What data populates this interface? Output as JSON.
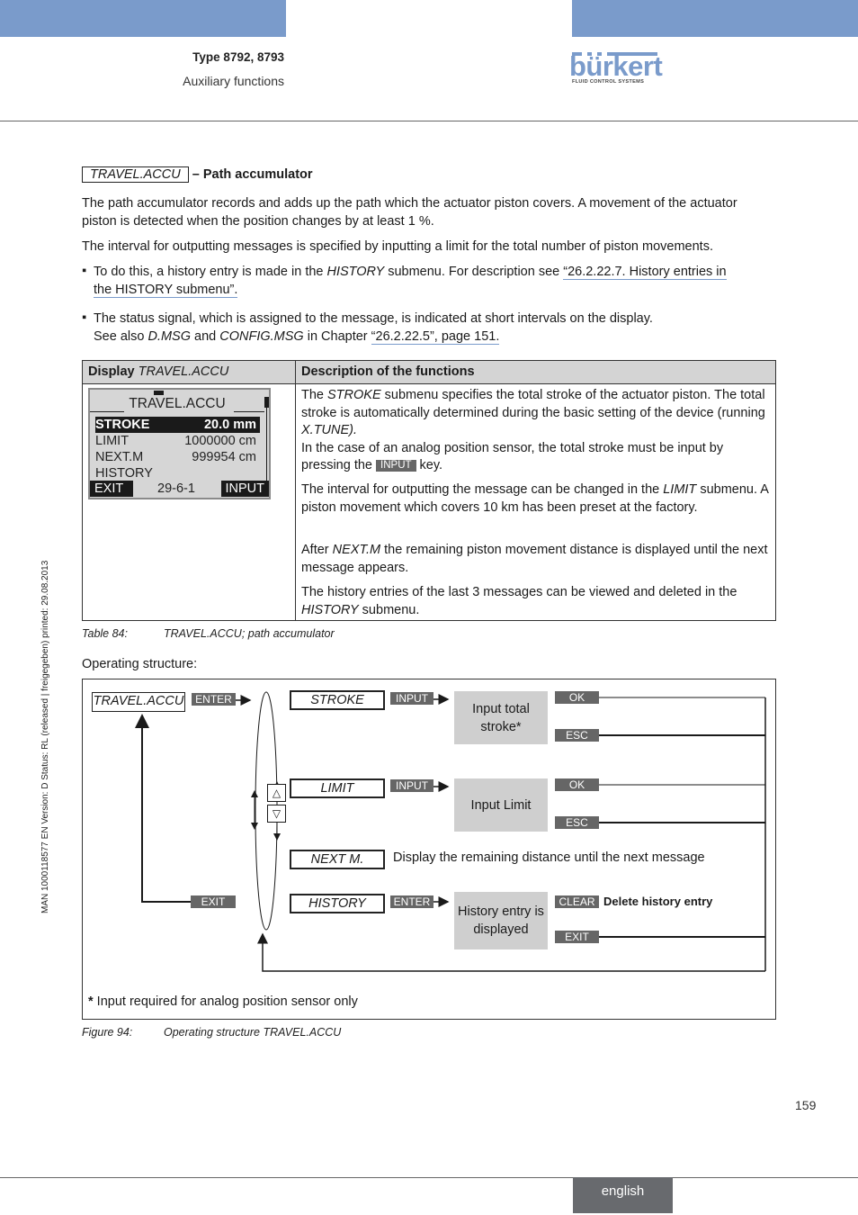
{
  "header": {
    "type": "Type 8792, 8793",
    "section": "Auxiliary functions",
    "brand": "bürkert",
    "brand_tagline": "FLUID CONTROL SYSTEMS",
    "brand_color": "#7a9bcb"
  },
  "side_note": "MAN  1000118577  EN  Version: D  Status: RL (released | freigegeben)  printed: 29.08.2013",
  "section": {
    "menu_label": "TRAVEL.ACCU",
    "title": "– Path accumulator",
    "para1": "The path accumulator records and adds up the path which the actuator piston covers. A movement of the actuator piston is detected when the position changes by at least 1 %.",
    "para2": "The interval for outputting messages is specified by inputting a limit for the total number of piston movements.",
    "bullet1": {
      "pre": "To do this, a history entry is made in the ",
      "em": "HISTORY",
      "mid": " submenu. For description see ",
      "link1": "“26.2.22.7. History entries in ",
      "link2": "the HISTORY submenu”."
    },
    "bullet2": {
      "line1": "The status signal, which is assigned to the message, is indicated at short intervals on the display.",
      "pre": "See also ",
      "em1": "D.MSG",
      "and": " and ",
      "em2": "CONFIG.MSG",
      "mid": " in Chapter ",
      "link": "“26.2.22.5”, page 151."
    }
  },
  "table": {
    "col1_header_bold": "Display ",
    "col1_header_italic": "TRAVEL.ACCU",
    "col2_header": "Description of the functions",
    "lcd": {
      "title": "TRAVEL.ACCU",
      "rows": [
        {
          "label": "STROKE",
          "value": "20.0 mm",
          "selected": true
        },
        {
          "label": "LIMIT",
          "value": "1000000 cm",
          "selected": false
        },
        {
          "label": "NEXT.M",
          "value": "999954 cm",
          "selected": false
        },
        {
          "label": "HISTORY",
          "value": "",
          "selected": false
        }
      ],
      "left_key": "EXIT",
      "middle": "29-6-1",
      "right_key": "INPUT"
    },
    "desc": {
      "p1_a": "The ",
      "p1_em": "STROKE",
      "p1_b": " submenu specifies the total stroke of the actuator piston. The total stroke is automatically determined during the basic setting of the device (running ",
      "p1_em2": "X.TUNE).",
      "p1_c": "In the case of an analog position sensor, the total stroke must be input by pressing the ",
      "p1_key": "INPUT",
      "p1_d": " key.",
      "p2_a": "The interval for outputting the message can be changed in the ",
      "p2_em": "LIMIT",
      "p2_b": " submenu. A piston movement which covers 10 km has been preset at the factory.",
      "p3_a": "After ",
      "p3_em": "NEXT.M",
      "p3_b": " the remaining piston movement distance is displayed until the next message appears.",
      "p4_a": "The history entries of the last 3 messages can be viewed and deleted in the ",
      "p4_em": "HISTORY",
      "p4_b": " submenu."
    },
    "caption_label": "Table 84:",
    "caption_text": "TRAVEL.ACCU; path accumulator"
  },
  "operating_structure_label": "Operating structure:",
  "diagram": {
    "root": "TRAVEL.ACCU",
    "enter_key": "ENTER",
    "exit_key": "EXIT",
    "items": [
      {
        "name": "STROKE",
        "key": "INPUT",
        "box": "Input total stroke*",
        "actions": [
          "OK",
          "ESC"
        ]
      },
      {
        "name": "LIMIT",
        "key": "INPUT",
        "box": "Input Limit",
        "actions": [
          "OK",
          "ESC"
        ]
      },
      {
        "name": "NEXT M.",
        "text": "Display the remaining distance until the next message"
      },
      {
        "name": "HISTORY",
        "key": "ENTER",
        "box": "History entry is displayed",
        "actions": [
          "CLEAR",
          "EXIT"
        ],
        "clear_text": "Delete history entry"
      }
    ],
    "footnote_star": "*",
    "footnote": " Input required for analog position sensor only",
    "caption_label": "Figure 94:",
    "caption_text": "Operating structure TRAVEL.ACCU"
  },
  "footer": {
    "page_number": "159",
    "language": "english"
  }
}
